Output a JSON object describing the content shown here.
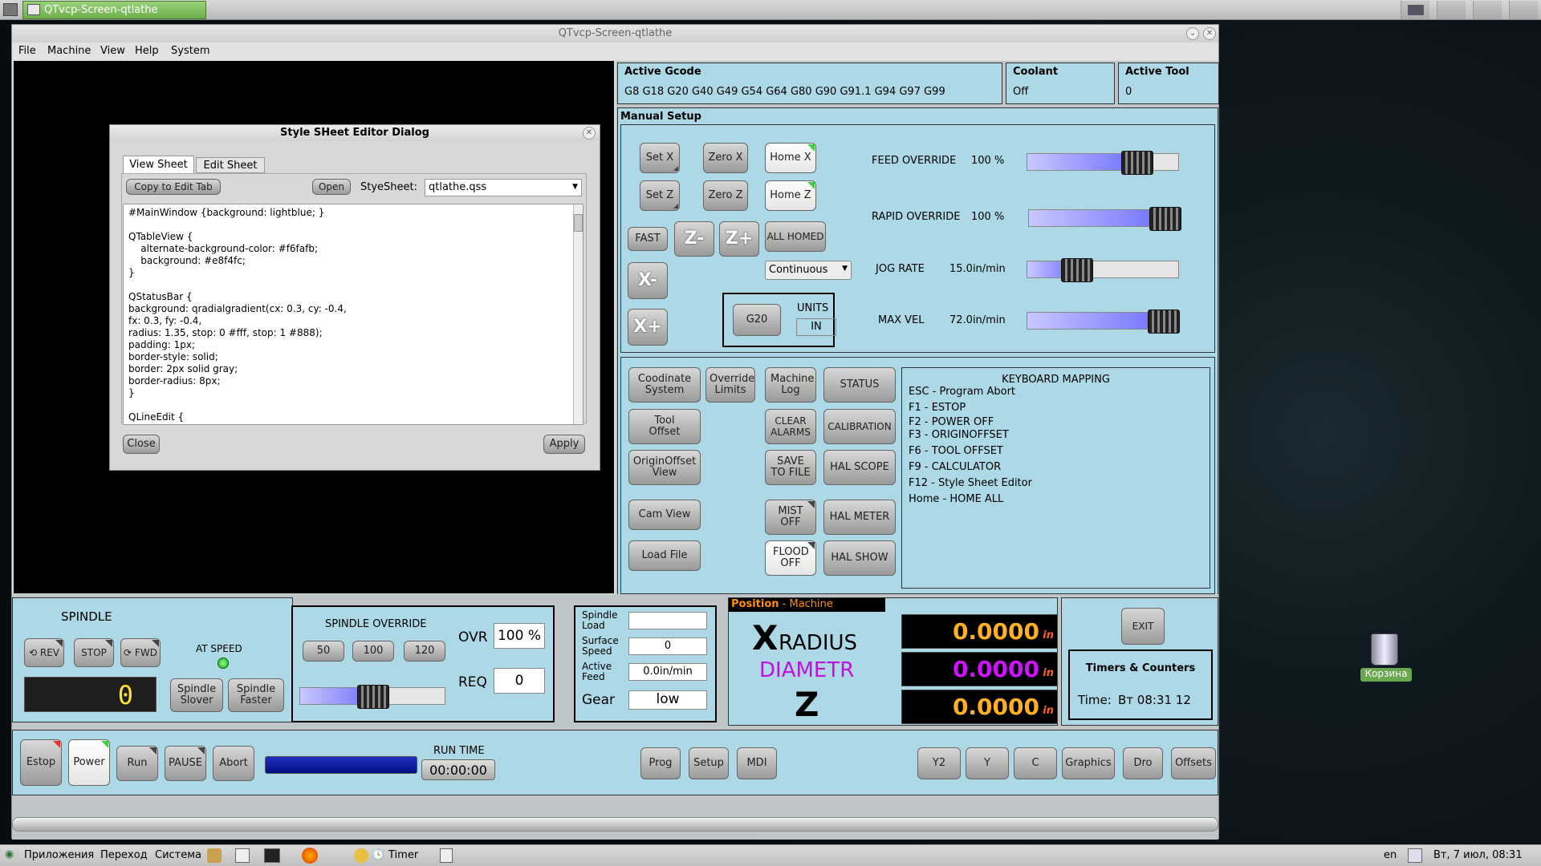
{
  "top_panel": {
    "task_title": "QTvcp-Screen-qtlathe"
  },
  "window": {
    "title": "QTvcp-Screen-qtlathe",
    "menu": [
      "File",
      "Machine",
      "View",
      "Help",
      "System"
    ]
  },
  "active_gcode": {
    "label": "Active Gcode",
    "value": "G8 G18 G20 G40 G49 G54 G64 G80 G90 G91.1 G94 G97 G99"
  },
  "coolant": {
    "label": "Coolant",
    "value": "Off"
  },
  "active_tool": {
    "label": "Active Tool",
    "value": "0"
  },
  "manual_setup": {
    "title": "Manual Setup",
    "set_x": "Set X",
    "zero_x": "Zero X",
    "home_x": "Home X",
    "set_z": "Set Z",
    "zero_z": "Zero Z",
    "home_z": "Home Z",
    "fast": "FAST",
    "z_minus": "Z-",
    "z_plus": "Z+",
    "all_homed": "ALL HOMED",
    "x_minus": "X-",
    "x_plus": "X+",
    "jog_mode": "Continuous",
    "g20": "G20",
    "units_label": "UNITS",
    "units_value": "IN"
  },
  "overrides": {
    "feed_label": "FEED OVERRIDE",
    "feed_value": "100 %",
    "feed_level": 0.78,
    "rapid_label": "RAPID OVERRIDE",
    "rapid_value": "100 %",
    "rapid_level": 1.0,
    "jog_label": "JOG RATE",
    "jog_value": "15.0in/min",
    "jog_level": 0.28,
    "maxvel_label": "MAX VEL",
    "maxvel_value": "72.0in/min",
    "maxvel_level": 1.0
  },
  "buttons": {
    "coord_system": "Coodinate System",
    "override_limits": "Override Limits",
    "machine_log": "Machine Log",
    "status": "STATUS",
    "tool_offset": "Tool Offset",
    "clear_alarms": "CLEAR ALARMS",
    "calibration": "CALIBRATION",
    "origin_offset_view": "OriginOffset View",
    "save_to_file": "SAVE TO FILE",
    "hal_scope": "HAL SCOPE",
    "cam_view": "Cam View",
    "mist_off": "MIST OFF",
    "hal_meter": "HAL METER",
    "load_file": "Load File",
    "flood_off": "FLOOD OFF",
    "hal_show": "HAL SHOW"
  },
  "keyboard": {
    "title": "KEYBOARD MAPPING",
    "lines": [
      "ESC - Program Abort",
      "F1 - ESTOP",
      "F2 - POWER OFF",
      "F3 - ORIGINOFFSET",
      "F6 - TOOL OFFSET",
      "F9 - CALCULATOR",
      "F12 - Style Sheet Editor",
      "Home - HOME ALL"
    ]
  },
  "spindle": {
    "title": "SPINDLE",
    "rev": "REV",
    "stop": "STOP",
    "fwd": "FWD",
    "at_speed": "AT SPEED",
    "lcd": "0",
    "slower": "Spindle Slover",
    "faster": "Spindle Faster"
  },
  "spindle_override": {
    "title": "SPINDLE OVERRIDE",
    "b50": "50",
    "b100": "100",
    "b120": "120",
    "ovr_label": "OVR",
    "ovr_value": "100 %",
    "req_label": "REQ",
    "req_value": "0",
    "level": 0.5
  },
  "spindle_info": {
    "load_label": "Spindle Load",
    "surface_label": "Surface Speed",
    "surface_value": "0",
    "feed_label": "Active Feed",
    "feed_value": "0.0in/min",
    "gear_label": "Gear",
    "gear_value": "low"
  },
  "position": {
    "title": "Position",
    "mode": "- Machine",
    "x_letter": "X",
    "x_label": "RADIUS",
    "d_label": "DIAMETR",
    "z_letter": "Z",
    "x_value": "0.0000",
    "d_value": "0.0000",
    "z_value": "0.0000",
    "unit": "in"
  },
  "exit_panel": {
    "exit": "EXIT",
    "timers_title": "Timers & Counters",
    "time_label": "Time:",
    "time_value": "Вт 08:31 12"
  },
  "action_bar": {
    "estop": "Estop",
    "power": "Power",
    "run": "Run",
    "pause": "PAUSE",
    "abort": "Abort",
    "run_time_label": "RUN TIME",
    "run_time": "00:00:00",
    "prog": "Prog",
    "setup": "Setup",
    "mdi": "MDI",
    "y2": "Y2",
    "y": "Y",
    "c": "C",
    "graphics": "Graphics",
    "dro": "Dro",
    "offsets": "Offsets"
  },
  "dialog": {
    "title": "Style SHeet Editor Dialog",
    "tab_view": "View Sheet",
    "tab_edit": "Edit Sheet",
    "copy_btn": "Copy to Edit Tab",
    "open_btn": "Open",
    "stylesheet_label": "StyeSheet:",
    "stylesheet_value": "qtlathe.qss",
    "content": "#MainWindow {background: lightblue; }\n\nQTableView {\n    alternate-background-color: #f6fafb;\n    background: #e8f4fc;\n}\n\nQStatusBar {\nbackground: qradialgradient(cx: 0.3, cy: -0.4,\nfx: 0.3, fy: -0.4,\nradius: 1.35, stop: 0 #fff, stop: 1 #888);\npadding: 1px;\nborder-style: solid;\nborder: 2px solid gray;\nborder-radius: 8px;\n}\n\nQLineEdit {",
    "close_btn": "Close",
    "apply_btn": "Apply"
  },
  "desktop": {
    "trash_label": "Корзина"
  },
  "bottom_panel": {
    "apps": "Приложения",
    "places": "Переход",
    "system": "Система",
    "timer": "Timer",
    "lang": "en",
    "clock": "Вт,  7 июл, 08:31"
  }
}
